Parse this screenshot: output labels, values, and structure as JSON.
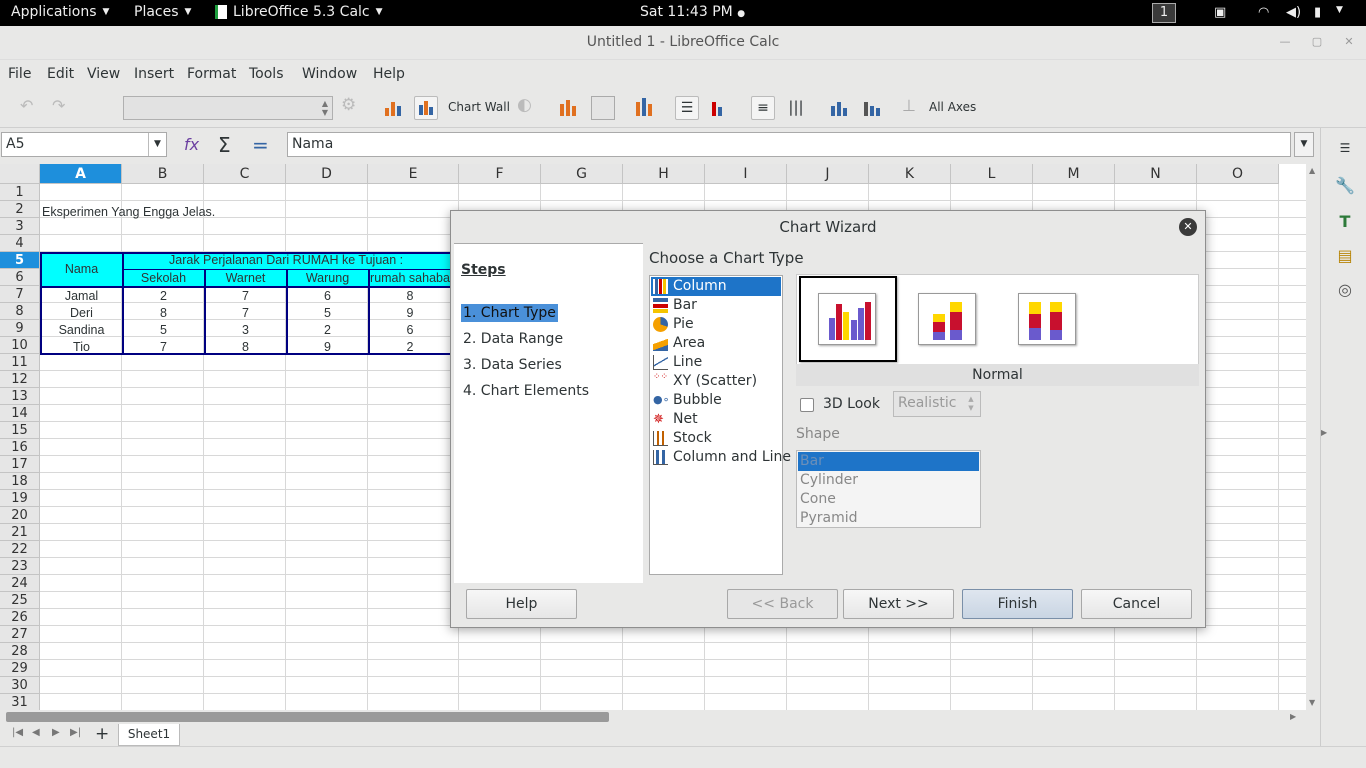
{
  "topbar": {
    "applications": "Applications",
    "places": "Places",
    "app_menu": "LibreOffice 5.3 Calc",
    "clock": "Sat 11:43 PM",
    "workspace": "1"
  },
  "window": {
    "title": "Untitled 1 - LibreOffice Calc"
  },
  "menubar": [
    "File",
    "Edit",
    "View",
    "Insert",
    "Format",
    "Tools",
    "Window",
    "Help"
  ],
  "toolbar": {
    "chart_wall": "Chart Wall",
    "all_axes": "All Axes"
  },
  "formula_bar": {
    "name_box": "A5",
    "content": "Nama"
  },
  "columns": [
    "A",
    "B",
    "C",
    "D",
    "E",
    "F",
    "G",
    "H",
    "I",
    "J",
    "K",
    "L",
    "M",
    "N",
    "O"
  ],
  "rows": [
    "1",
    "2",
    "3",
    "4",
    "5",
    "6",
    "7",
    "8",
    "9",
    "10",
    "11",
    "12",
    "13",
    "14",
    "15",
    "16",
    "17",
    "18",
    "19",
    "20",
    "21",
    "22",
    "23",
    "24",
    "25",
    "26",
    "27",
    "28",
    "29",
    "30",
    "31"
  ],
  "sheet": {
    "title": "Eksperimen Yang Engga Jelas.",
    "header_nama": "Nama",
    "header_group": "Jarak Perjalanan Dari RUMAH ke Tujuan :",
    "subheaders": [
      "Sekolah",
      "Warnet",
      "Warung",
      "rumah sahaba"
    ],
    "data": [
      {
        "nama": "Jamal",
        "v": [
          "2",
          "7",
          "6",
          "8"
        ]
      },
      {
        "nama": "Deri",
        "v": [
          "8",
          "7",
          "5",
          "9"
        ]
      },
      {
        "nama": "Sandina",
        "v": [
          "5",
          "3",
          "2",
          "6"
        ]
      },
      {
        "nama": "Tio",
        "v": [
          "7",
          "8",
          "9",
          "2"
        ]
      }
    ]
  },
  "sheet_tab": "Sheet1",
  "dialog": {
    "title": "Chart Wizard",
    "steps_heading": "Steps",
    "steps": [
      "1. Chart Type",
      "2. Data Range",
      "3. Data Series",
      "4. Chart Elements"
    ],
    "choose_label": "Choose a Chart Type",
    "chart_types": [
      "Column",
      "Bar",
      "Pie",
      "Area",
      "Line",
      "XY (Scatter)",
      "Bubble",
      "Net",
      "Stock",
      "Column and Line"
    ],
    "variant_name": "Normal",
    "look3d_label": "3D Look",
    "look3d_value": "Realistic",
    "shape_label": "Shape",
    "shapes": [
      "Bar",
      "Cylinder",
      "Cone",
      "Pyramid"
    ],
    "buttons": {
      "help": "Help",
      "back": "<< Back",
      "next": "Next >>",
      "finish": "Finish",
      "cancel": "Cancel"
    }
  },
  "colors": {
    "accent": "#1e8fdc",
    "table_fill": "#00ffff",
    "table_border": "#000080",
    "selection": "#1e74c8"
  }
}
